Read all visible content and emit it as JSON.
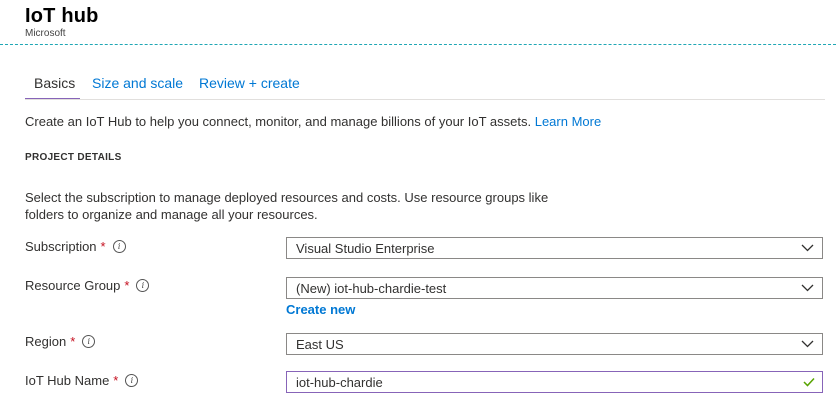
{
  "header": {
    "title": "IoT hub",
    "subtitle": "Microsoft"
  },
  "tabs": [
    {
      "label": "Basics",
      "active": true
    },
    {
      "label": "Size and scale",
      "active": false
    },
    {
      "label": "Review + create",
      "active": false
    }
  ],
  "intro": {
    "text": "Create an IoT Hub to help you connect, monitor, and manage billions of your IoT assets.",
    "link": "Learn More"
  },
  "project_details": {
    "heading": "PROJECT DETAILS",
    "description": "Select the subscription to manage deployed resources and costs. Use resource groups like folders to organize and manage all your resources."
  },
  "form": {
    "subscription": {
      "label": "Subscription",
      "value": "Visual Studio Enterprise"
    },
    "resource_group": {
      "label": "Resource Group",
      "value": "(New) iot-hub-chardie-test",
      "create_new": "Create new"
    },
    "region": {
      "label": "Region",
      "value": "East US"
    },
    "hub_name": {
      "label": "IoT Hub Name",
      "value": "iot-hub-chardie"
    },
    "required_marker": "*",
    "info_glyph": "i"
  },
  "colors": {
    "accent": "#0078d4",
    "tab_underline": "#8764b8",
    "required": "#c50f1f",
    "valid_check": "#57a300",
    "header_rule": "#1fa7b5"
  },
  "icons": {
    "dropdown": "chevron-down-icon",
    "info": "info-icon",
    "valid": "checkmark-icon"
  }
}
